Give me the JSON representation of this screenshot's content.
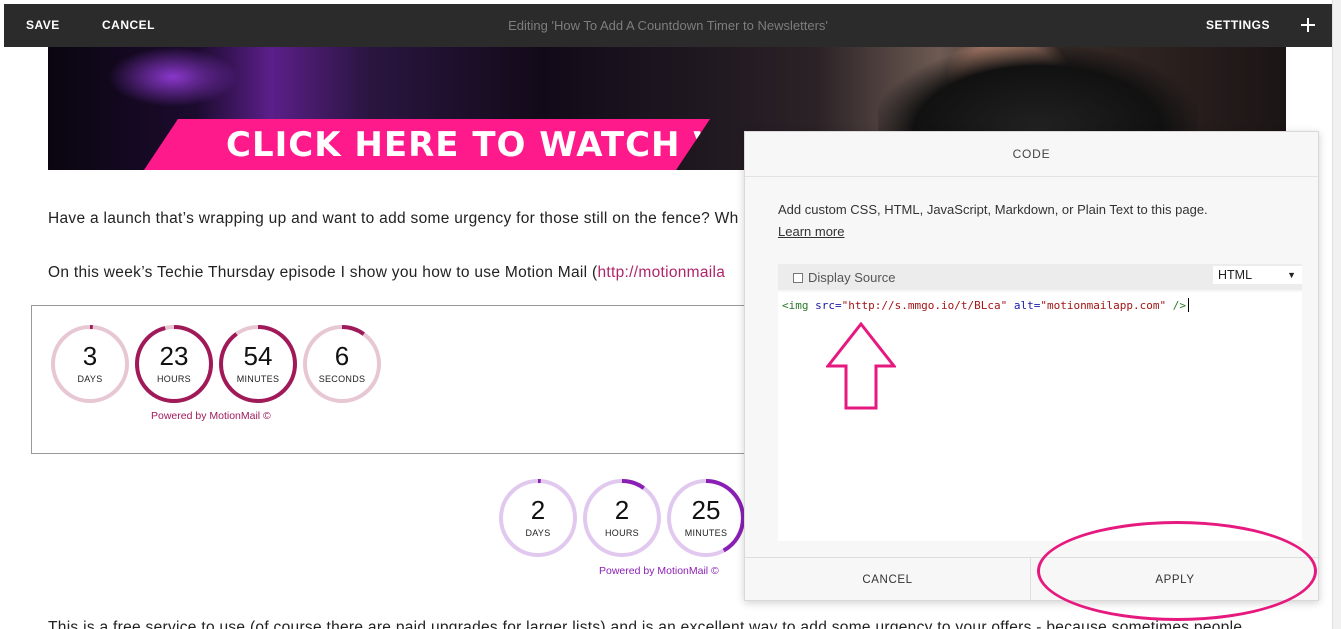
{
  "toolbar": {
    "save_label": "SAVE",
    "cancel_label": "CANCEL",
    "title": "Editing 'How To Add A Countdown Timer to Newsletters'",
    "settings_label": "SETTINGS",
    "add_icon": "plus-icon"
  },
  "hero": {
    "cta_text": "CLICK HERE TO WATCH VIDEO",
    "cta_color": "#ff1a8c"
  },
  "content": {
    "paragraph1": "Have a launch that’s wrapping up and want to add some urgency for those still on the fence? Wh",
    "paragraph2_prefix": "On this week’s Techie Thursday episode I show you how to use Motion Mail (",
    "paragraph2_link": "http://motionmaila",
    "paragraph3": "This is a free service to use (of course there are paid upgrades for larger lists) and is an excellent way to add some urgency to your offers - because sometimes people"
  },
  "timer1": {
    "units": [
      {
        "value": "3",
        "label": "DAYS",
        "progress": 0.0
      },
      {
        "value": "23",
        "label": "HOURS",
        "progress": 0.96
      },
      {
        "value": "54",
        "label": "MINUTES",
        "progress": 0.9
      },
      {
        "value": "6",
        "label": "SECONDS",
        "progress": 0.1
      }
    ],
    "powered_by": "Powered by MotionMail ©",
    "color": "#a01a5a",
    "track_color": "#e7c7d3"
  },
  "timer2": {
    "units": [
      {
        "value": "2",
        "label": "DAYS",
        "progress": 0.0
      },
      {
        "value": "2",
        "label": "HOURS",
        "progress": 0.1
      },
      {
        "value": "25",
        "label": "MINUTES",
        "progress": 0.42
      }
    ],
    "powered_by": "Powered by MotionMail ©",
    "color": "#8a1fb3",
    "track_color": "#e1c8ef"
  },
  "code_modal": {
    "header": "CODE",
    "description": "Add custom CSS, HTML, JavaScript, Markdown, or Plain Text to this page.",
    "learn_more": "Learn more",
    "display_source_label": "Display Source",
    "language": "HTML",
    "code": {
      "open": "<img ",
      "src_attr": "src=",
      "src_val": "\"http://s.mmgo.io/t/BLca\"",
      "alt_attr": "alt=",
      "alt_val": "\"motionmailapp.com\"",
      "close": " />"
    },
    "cancel_label": "CANCEL",
    "apply_label": "APPLY"
  },
  "annotations": {
    "arrow_color": "#e6197f",
    "ellipse_color": "#e6197f"
  }
}
